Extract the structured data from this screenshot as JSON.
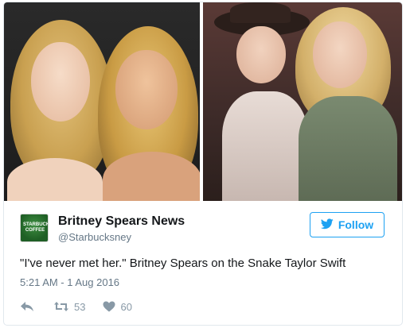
{
  "tweet": {
    "author_name": "Britney Spears News",
    "author_handle": "@Starbucksney",
    "avatar_text": "STARBUCKS COFFEE",
    "text": "\"I've never met her.\" Britney Spears on the Snake Taylor Swift",
    "timestamp": "5:21 AM - 1 Aug 2016",
    "follow_label": "Follow",
    "retweet_count": "53",
    "like_count": "60"
  },
  "colors": {
    "accent": "#1da1f2",
    "muted": "#657786",
    "icon": "#8899a6"
  },
  "icons": {
    "bird": "twitter-bird-icon",
    "reply": "reply-icon",
    "retweet": "retweet-icon",
    "like": "heart-icon"
  }
}
